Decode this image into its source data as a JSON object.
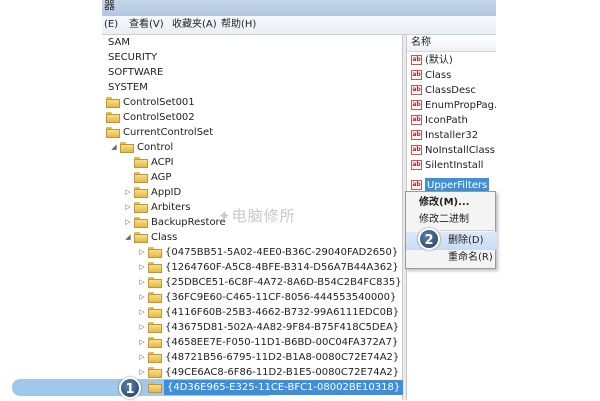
{
  "window": {
    "title_fragment": "器"
  },
  "menubar": {
    "items": [
      "(E)",
      "查看(V)",
      "收藏夹(A)",
      "帮助(H)"
    ]
  },
  "tree": {
    "root_items": [
      "SAM",
      "SECURITY",
      "SOFTWARE",
      "SYSTEM"
    ],
    "controlset001": "ControlSet001",
    "controlset002": "ControlSet002",
    "currentcontrolset": "CurrentControlSet",
    "control": "Control",
    "control_children": [
      "ACPI",
      "AGP",
      "AppID",
      "Arbiters",
      "BackupRestore"
    ],
    "class": "Class",
    "class_children": [
      "{0475BB51-5A02-4EE0-B36C-29040FAD2650}",
      "{1264760F-A5C8-4BFE-B314-D56A7B44A362}",
      "{25DBCE51-6C8F-4A72-8A6D-B54C2B4FC835}",
      "{36FC9E60-C465-11CF-8056-444553540000}",
      "{4116F60B-25B3-4662-B732-99A6111EDC0B}",
      "{43675D81-502A-4A82-9F84-B75F418C5DEA}",
      "{4658EE7E-F050-11D1-B6BD-00C04FA372A7}",
      "{48721B56-6795-11D2-B1A8-0080C72E74A2}",
      "{49CE6AC8-6F86-11D2-B1E5-0080C72E74A2}"
    ],
    "selected_key": "{4D36E965-E325-11CE-BFC1-08002BE10318}"
  },
  "values_pane": {
    "column_name": "名称",
    "items": [
      "(默认)",
      "Class",
      "ClassDesc",
      "EnumPropPag...",
      "IconPath",
      "Installer32",
      "NoInstallClass",
      "SilentInstall"
    ],
    "selected_value": "UpperFilters",
    "type_glyph": "ab"
  },
  "context_menu": {
    "modify": "修改(M)...",
    "modify_binary": "修改二进制",
    "delete": "删除(D)",
    "rename": "重命名(R)"
  },
  "watermark": "电脑修所",
  "watermark_logo": "✦",
  "badges": {
    "step1": "1",
    "step2": "2"
  },
  "colors": {
    "selection": "#3d8fd8",
    "highlight": "#9fc8ec",
    "badge": "#2c4d78"
  }
}
